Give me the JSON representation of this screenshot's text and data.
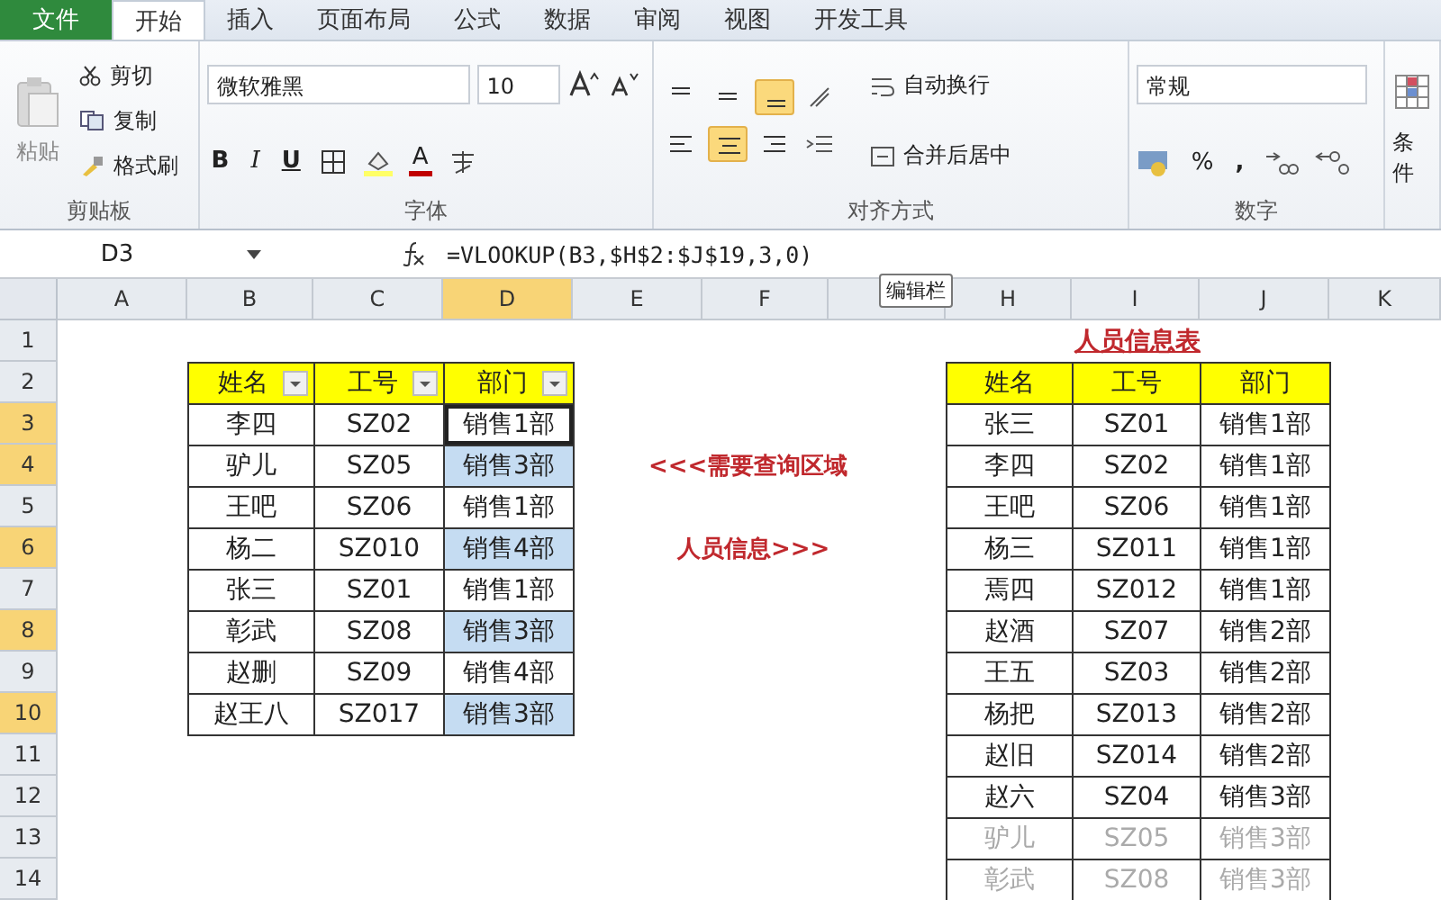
{
  "ribbon_tabs": [
    {
      "label": "文件",
      "kind": "file",
      "selected": false
    },
    {
      "label": "开始",
      "kind": "tab",
      "selected": true
    },
    {
      "label": "插入",
      "kind": "tab",
      "selected": false
    },
    {
      "label": "页面布局",
      "kind": "tab",
      "selected": false
    },
    {
      "label": "公式",
      "kind": "tab",
      "selected": false
    },
    {
      "label": "数据",
      "kind": "tab",
      "selected": false
    },
    {
      "label": "审阅",
      "kind": "tab",
      "selected": false
    },
    {
      "label": "视图",
      "kind": "tab",
      "selected": false
    },
    {
      "label": "开发工具",
      "kind": "tab",
      "selected": false
    }
  ],
  "clipboard": {
    "paste": "粘贴",
    "cut": "剪切",
    "copy": "复制",
    "painter": "格式刷",
    "group": "剪贴板"
  },
  "font": {
    "name": "微软雅黑",
    "size": "10",
    "bold": "B",
    "italic": "I",
    "underline": "U",
    "color_letter": "A",
    "group": "字体"
  },
  "alignment": {
    "vertical": [
      {
        "selected": false
      },
      {
        "selected": false
      },
      {
        "selected": true
      }
    ],
    "horizontal": [
      {
        "selected": false
      },
      {
        "selected": true
      },
      {
        "selected": false
      }
    ],
    "wrap": "自动换行",
    "merge": "合并后居中",
    "group": "对齐方式"
  },
  "number": {
    "format": "常规",
    "percent": "%",
    "comma": ",",
    "group": "数字"
  },
  "styles": {
    "conditional": "条件"
  },
  "formula_bar": {
    "name_box": "D3",
    "formula": "=VLOOKUP(B3,$H$2:$J$19,3,0)",
    "tooltip": "编辑栏"
  },
  "columns": [
    {
      "label": "A",
      "selected": false
    },
    {
      "label": "B",
      "selected": false
    },
    {
      "label": "C",
      "selected": false
    },
    {
      "label": "D",
      "selected": true
    },
    {
      "label": "E",
      "selected": false
    },
    {
      "label": "F",
      "selected": false
    },
    {
      "selected": false
    },
    {
      "label": "H",
      "selected": false
    },
    {
      "label": "I",
      "selected": false
    },
    {
      "label": "J",
      "selected": false
    },
    {
      "label": "K",
      "selected": false
    }
  ],
  "rows": [
    {
      "label": "1",
      "selected": false
    },
    {
      "label": "2",
      "selected": false
    },
    {
      "label": "3",
      "selected": true
    },
    {
      "label": "4",
      "selected": true
    },
    {
      "label": "5",
      "selected": false
    },
    {
      "label": "6",
      "selected": true
    },
    {
      "label": "7",
      "selected": false
    },
    {
      "label": "8",
      "selected": true
    },
    {
      "label": "9",
      "selected": false
    },
    {
      "label": "10",
      "selected": true
    },
    {
      "label": "11",
      "selected": false
    },
    {
      "label": "12",
      "selected": false
    },
    {
      "label": "13",
      "selected": false
    },
    {
      "label": "14",
      "selected": false
    }
  ],
  "lookup_table": {
    "headers": [
      "姓名",
      "工号",
      "部门"
    ],
    "rows": [
      {
        "name": "李四",
        "id": "SZ02",
        "dept": "销售1部",
        "highlighted": false,
        "active": true
      },
      {
        "name": "驴儿",
        "id": "SZ05",
        "dept": "销售3部",
        "highlighted": true,
        "active": false
      },
      {
        "name": "王吧",
        "id": "SZ06",
        "dept": "销售1部",
        "highlighted": false,
        "active": false
      },
      {
        "name": "杨二",
        "id": "SZ010",
        "dept": "销售4部",
        "highlighted": true,
        "active": false
      },
      {
        "name": "张三",
        "id": "SZ01",
        "dept": "销售1部",
        "highlighted": false,
        "active": false
      },
      {
        "name": "彰武",
        "id": "SZ08",
        "dept": "销售3部",
        "highlighted": true,
        "active": false
      },
      {
        "name": "赵删",
        "id": "SZ09",
        "dept": "销售4部",
        "highlighted": false,
        "active": false
      },
      {
        "name": "赵王八",
        "id": "SZ017",
        "dept": "销售3部",
        "highlighted": true,
        "active": false
      }
    ]
  },
  "notes": [
    "<<<需要查询区域",
    "人员信息>>>"
  ],
  "info_table": {
    "title": "人员信息表",
    "headers": [
      "姓名",
      "工号",
      "部门"
    ],
    "rows": [
      {
        "name": "张三",
        "id": "SZ01",
        "dept": "销售1部",
        "faded": false
      },
      {
        "name": "李四",
        "id": "SZ02",
        "dept": "销售1部",
        "faded": false
      },
      {
        "name": "王吧",
        "id": "SZ06",
        "dept": "销售1部",
        "faded": false
      },
      {
        "name": "杨三",
        "id": "SZ011",
        "dept": "销售1部",
        "faded": false
      },
      {
        "name": "焉四",
        "id": "SZ012",
        "dept": "销售1部",
        "faded": false
      },
      {
        "name": "赵酒",
        "id": "SZ07",
        "dept": "销售2部",
        "faded": false
      },
      {
        "name": "王五",
        "id": "SZ03",
        "dept": "销售2部",
        "faded": false
      },
      {
        "name": "杨把",
        "id": "SZ013",
        "dept": "销售2部",
        "faded": false
      },
      {
        "name": "赵旧",
        "id": "SZ014",
        "dept": "销售2部",
        "faded": false
      },
      {
        "name": "赵六",
        "id": "SZ04",
        "dept": "销售3部",
        "faded": false
      },
      {
        "name": "驴儿",
        "id": "SZ05",
        "dept": "销售3部",
        "faded": true
      },
      {
        "name": "彰武",
        "id": "SZ08",
        "dept": "销售3部",
        "faded": true
      }
    ]
  }
}
